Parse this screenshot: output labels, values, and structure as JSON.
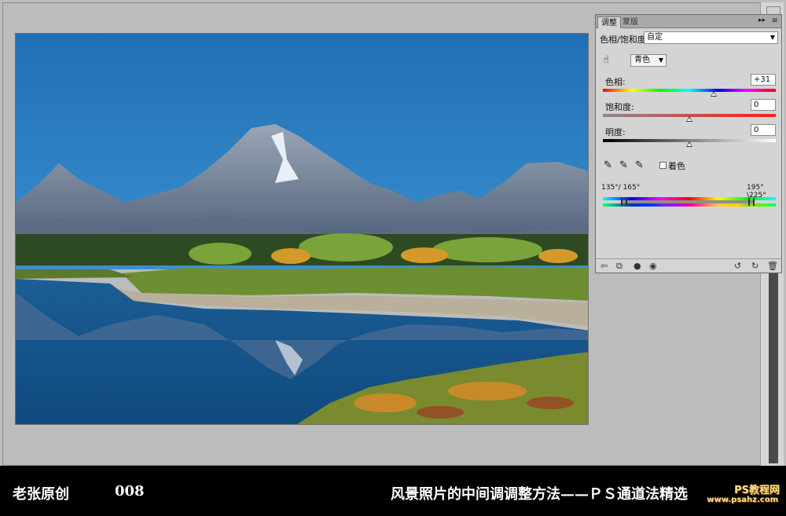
{
  "panel": {
    "tabs": [
      "调整",
      "蒙版"
    ],
    "menu_icon": "≡",
    "expand_icon": "▸▸",
    "adjustment_name": "色相/饱和度",
    "preset": "自定",
    "channel": "青色",
    "hue_label": "色相:",
    "hue_value": "+31",
    "hue_fraction": 0.64,
    "saturation_label": "饱和度:",
    "saturation_value": "0",
    "saturation_fraction": 0.5,
    "lightness_label": "明度:",
    "lightness_value": "0",
    "lightness_fraction": 0.5,
    "colorize_label": "着色",
    "range_left": "135°/ 165°",
    "range_right": "195°\\225°"
  },
  "caption": {
    "author": "老张原创",
    "number": "008",
    "title": "风景照片的中间调调整方法——ＰＳ通道法精选",
    "watermark": "PS教程网",
    "watermark_url": "www.psahz.com"
  }
}
